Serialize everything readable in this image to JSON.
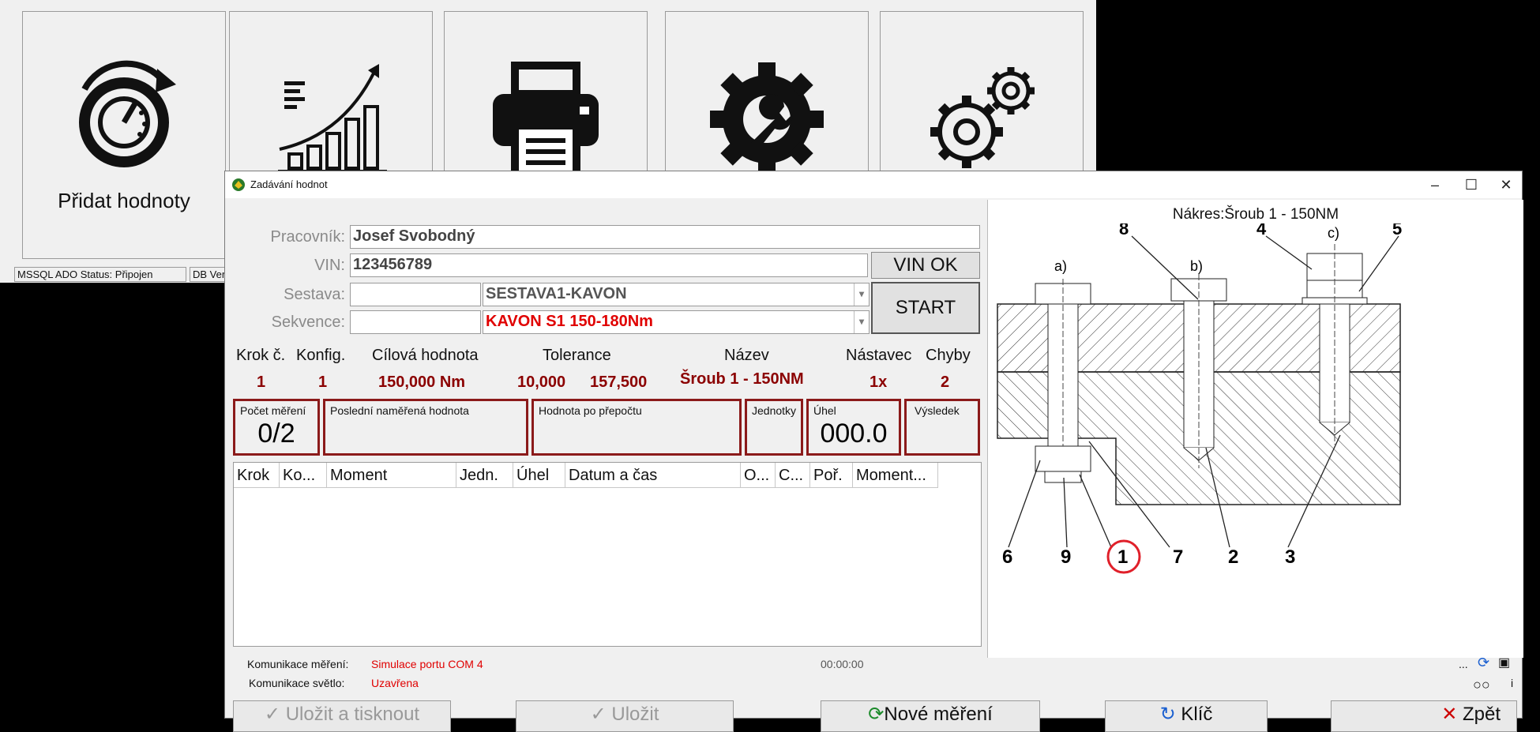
{
  "main_window": {
    "tiles": [
      {
        "icon": "speedometer-refresh-icon",
        "label": "Přidat hodnoty"
      },
      {
        "icon": "growth-chart-icon",
        "label": ""
      },
      {
        "icon": "printer-icon",
        "label": ""
      },
      {
        "icon": "wrench-gear-icon",
        "label": ""
      },
      {
        "icon": "settings-gears-icon",
        "label": ""
      }
    ],
    "status": [
      "MSSQL ADO Status: Připojen",
      "DB Ver"
    ]
  },
  "dialog": {
    "title": "Zadávání hodnot",
    "form": {
      "worker_label": "Pracovník:",
      "worker_value": "Josef Svobodný",
      "vin_label": "VIN:",
      "vin_value": "123456789",
      "vin_ok": "VIN OK",
      "assembly_label": "Sestava:",
      "assembly_value": "SESTAVA1-KAVON",
      "sequence_label": "Sekvence:",
      "sequence_value": "KAVON S1 150-180Nm",
      "start": "START"
    },
    "step_header": {
      "step": "Krok č.",
      "config": "Konfig.",
      "target": "Cílová hodnota",
      "tolerance": "Tolerance",
      "name": "Název",
      "bit": "Nástavec",
      "errors": "Chyby"
    },
    "step_values": {
      "step": "1",
      "config": "1",
      "target": "150,000 Nm",
      "tol_min": "10,000",
      "tol_max": "157,500",
      "name": "Šroub 1 - 150NM",
      "bit": "1x",
      "errors": "2"
    },
    "boxes": {
      "count_label": "Počet měření",
      "count_value": "0/2",
      "last_label": "Poslední naměřená hodnota",
      "recalc_label": "Hodnota po přepočtu",
      "units_label": "Jednotky",
      "angle_label": "Úhel",
      "angle_value": "000.0",
      "result_label": "Výsledek"
    },
    "grid_columns": [
      "Krok",
      "Ko...",
      "Moment",
      "Jedn.",
      "Úhel",
      "Datum a čas",
      "O...",
      "C...",
      "Poř.",
      "Moment..."
    ],
    "drawing": {
      "title": "Nákres:Šroub 1 - 150NM",
      "labels_top": [
        "8",
        "4",
        "5"
      ],
      "labels_sub": [
        "a)",
        "b)",
        "c)"
      ],
      "labels_bottom": [
        "6",
        "9",
        "1",
        "7",
        "2",
        "3"
      ]
    },
    "status": {
      "comm_label": "Komunikace měření:",
      "comm_value": "Simulace portu COM 4",
      "timer": "00:00:00",
      "light_label": "Komunikace světlo:",
      "light_value": "Uzavřena",
      "dots": "...",
      "i": "i"
    },
    "buttons": {
      "save_print": "Uložit a tisknout",
      "save": "Uložit",
      "new_measure": "Nové měření",
      "key": "Klíč",
      "back": "Zpět"
    }
  }
}
